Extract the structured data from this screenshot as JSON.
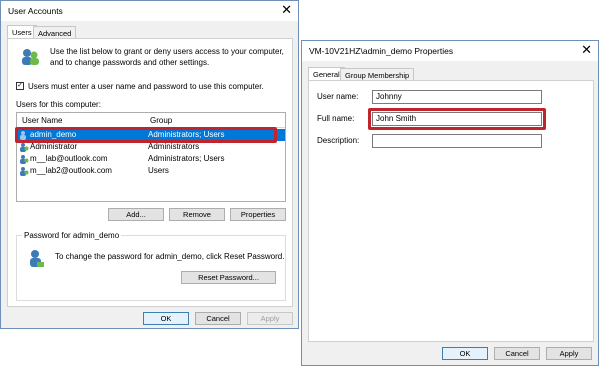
{
  "left_window": {
    "title": "User Accounts",
    "close_glyph": "✕",
    "tabs": [
      {
        "label": "Users"
      },
      {
        "label": "Advanced"
      }
    ],
    "description": "Use the list below to grant or deny users access to your computer,",
    "description2": "and to change passwords and other settings.",
    "checkbox_label": "Users must enter a user name and password to use this computer.",
    "checkbox_checked": true,
    "users_label": "Users for this computer:",
    "columns": {
      "name": "User Name",
      "group": "Group"
    },
    "users": [
      {
        "name": "admin_demo",
        "group": "Administrators; Users"
      },
      {
        "name": "Administrator",
        "group": "Administrators"
      },
      {
        "name": "m__lab@outlook.com",
        "group": "Administrators; Users"
      },
      {
        "name": "m__lab2@outlook.com",
        "group": "Users"
      }
    ],
    "buttons": {
      "add": "Add...",
      "remove": "Remove",
      "properties": "Properties"
    },
    "password_group_label": "Password for admin_demo",
    "password_text": "To change the password for admin_demo, click Reset Password.",
    "reset_button": "Reset Password...",
    "ok": "OK",
    "cancel": "Cancel",
    "apply": "Apply"
  },
  "right_window": {
    "title": "VM-10V21HZ\\admin_demo Properties",
    "close_glyph": "✕",
    "tabs": [
      {
        "label": "General"
      },
      {
        "label": "Group Membership"
      }
    ],
    "fields": {
      "username_label": "User name:",
      "username_value": "Johnny",
      "fullname_label": "Full name:",
      "fullname_value": "John Smith",
      "description_label": "Description:",
      "description_value": ""
    },
    "ok": "OK",
    "cancel": "Cancel",
    "apply": "Apply"
  },
  "colors": {
    "highlight": "#c0242c",
    "selection": "#0078d7"
  }
}
